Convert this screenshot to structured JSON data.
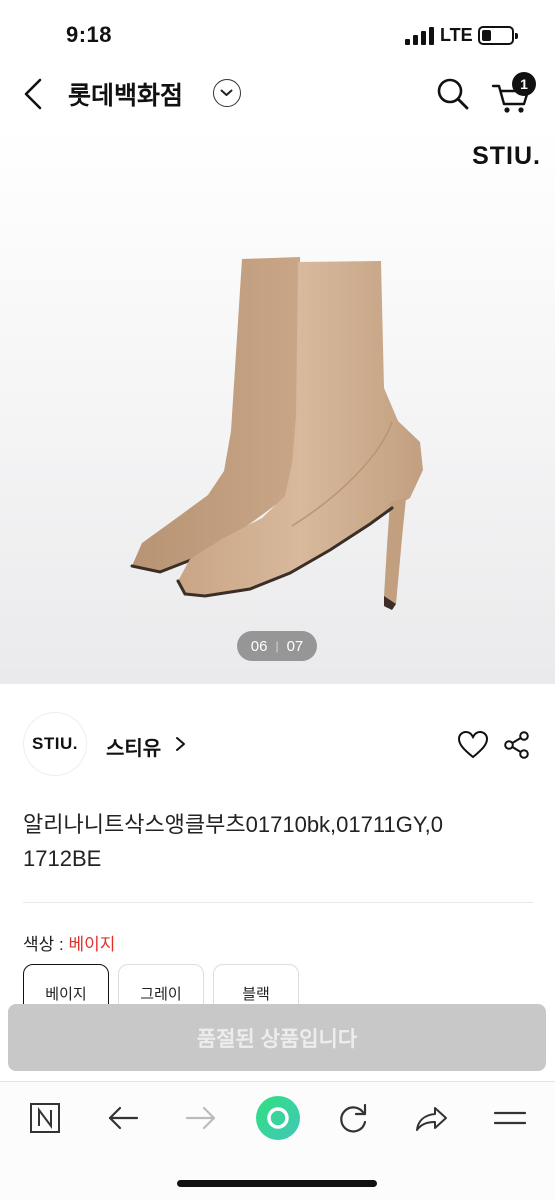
{
  "status_bar": {
    "time": "9:18",
    "network": "LTE"
  },
  "nav": {
    "store_title": "롯데백화점",
    "cart_count": "1"
  },
  "hero": {
    "brand_mark": "STIU.",
    "pager_current": "06",
    "pager_total": "07"
  },
  "brand": {
    "logo_text": "STIU.",
    "name": "스티유"
  },
  "product": {
    "title": "알리나니트삭스앵클부츠01710bk,01711GY,01712BE"
  },
  "option": {
    "label": "색상 : ",
    "selected": "베이지",
    "chips": [
      "베이지",
      "그레이",
      "블랙"
    ]
  },
  "cta": {
    "label": "품절된 상품입니다"
  },
  "colors": {
    "accent_red": "#e0312b",
    "boot_tan": "#d3b294",
    "soldout_gray": "#c8c8c8",
    "toolbar_green": "#3ed389"
  },
  "toolbar_icons": [
    "n-icon",
    "arrow-left-icon",
    "arrow-right-icon",
    "home-dot-icon",
    "refresh-icon",
    "share-arrow-icon",
    "menu-icon"
  ]
}
